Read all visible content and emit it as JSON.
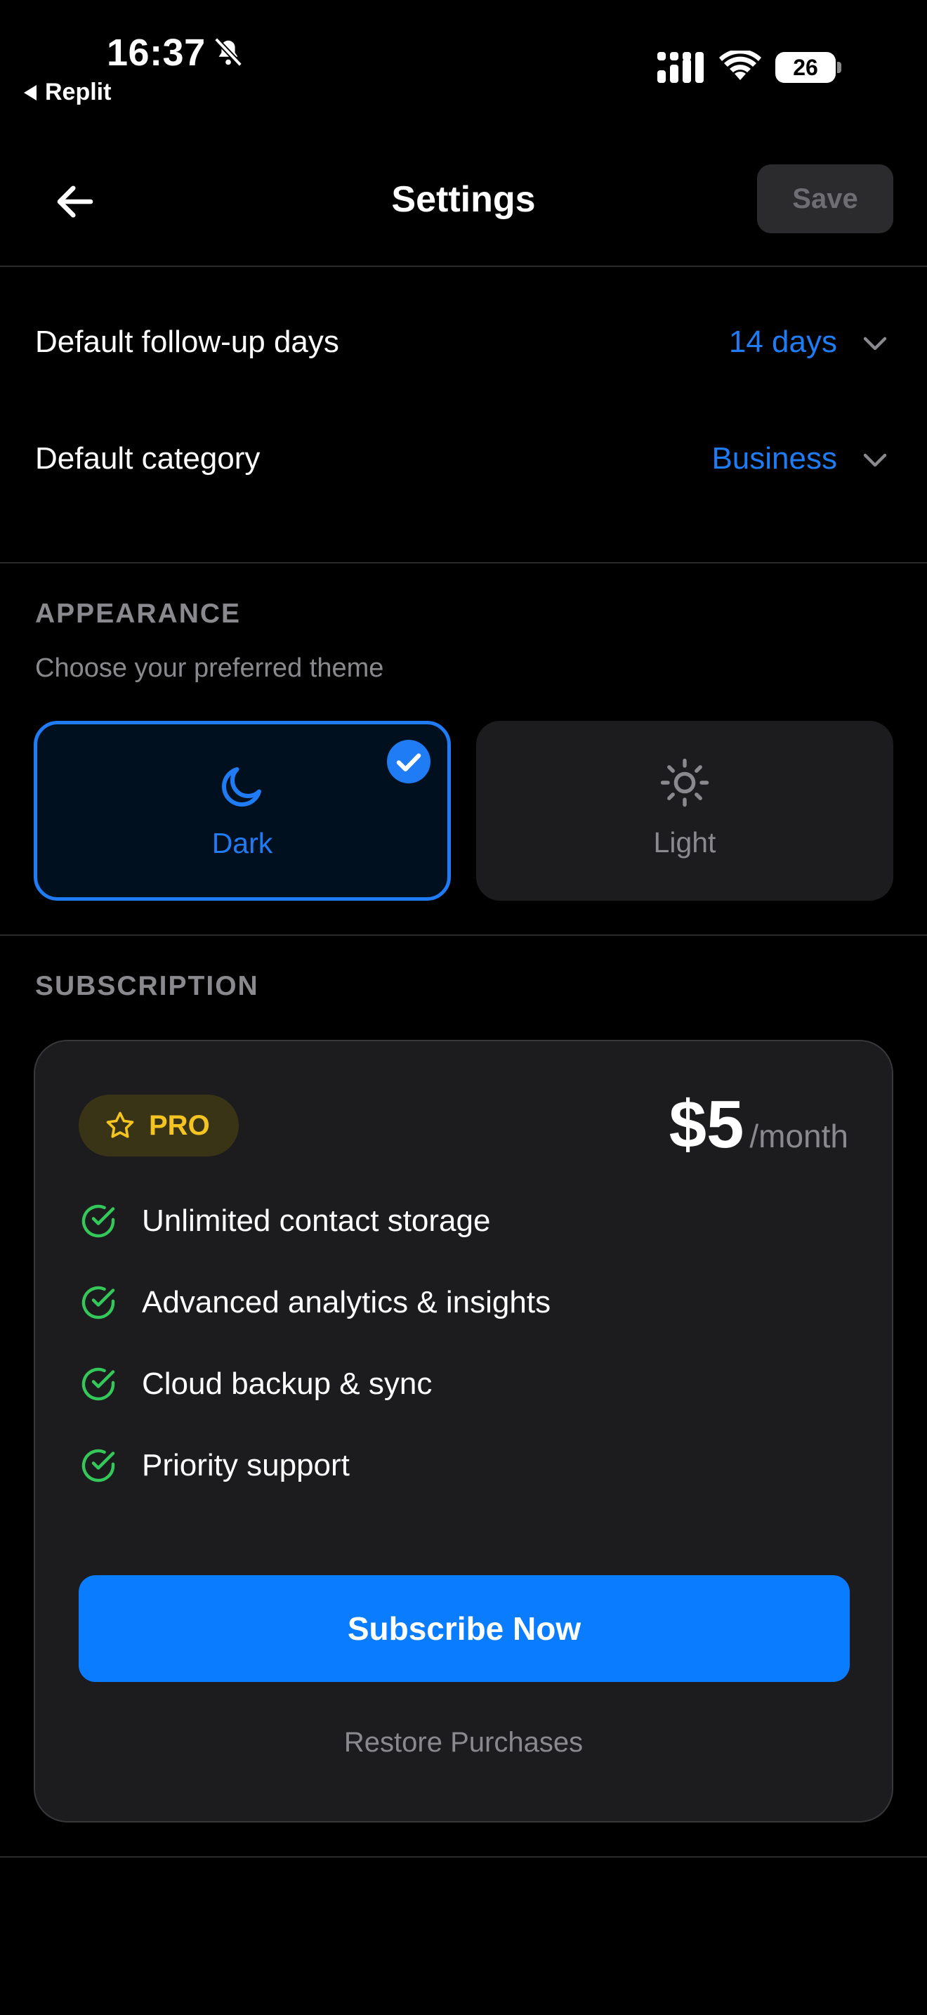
{
  "status_bar": {
    "time": "16:37",
    "back_app": "Replit",
    "battery": "26",
    "icons": [
      "bell-slash-icon",
      "cellular-signal-icon",
      "wifi-icon",
      "battery-icon"
    ]
  },
  "header": {
    "title": "Settings",
    "save_label": "Save"
  },
  "defaults": {
    "followup": {
      "label": "Default follow-up days",
      "value": "14 days"
    },
    "category": {
      "label": "Default category",
      "value": "Business"
    }
  },
  "appearance": {
    "heading": "APPEARANCE",
    "subtitle": "Choose your preferred theme",
    "options": [
      {
        "label": "Dark",
        "icon": "moon-icon",
        "selected": true
      },
      {
        "label": "Light",
        "icon": "sun-icon",
        "selected": false
      }
    ]
  },
  "subscription": {
    "heading": "SUBSCRIPTION",
    "badge": "PRO",
    "price": "$5",
    "period": "/month",
    "features": [
      "Unlimited contact storage",
      "Advanced analytics & insights",
      "Cloud backup & sync",
      "Priority support"
    ],
    "subscribe_label": "Subscribe Now",
    "restore_label": "Restore Purchases"
  },
  "colors": {
    "accent": "#1f7cf5",
    "button": "#0a7cff",
    "pro_gold": "#f4c520",
    "check_green": "#34c759",
    "background": "#000000",
    "card": "#1c1c1e"
  }
}
